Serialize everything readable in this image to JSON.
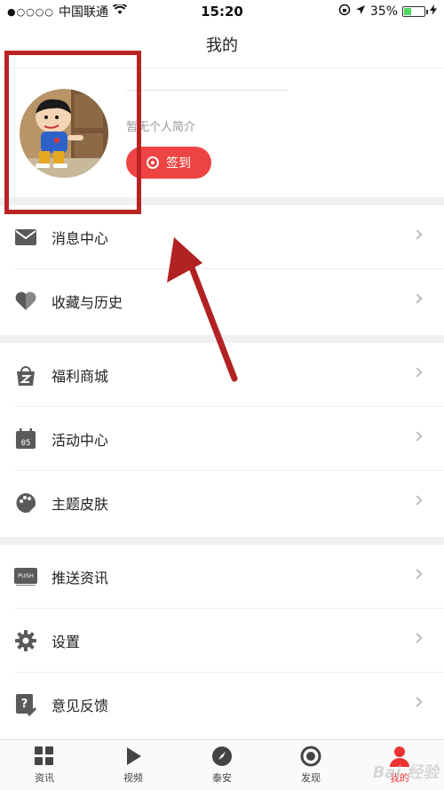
{
  "status_bar": {
    "carrier": "中国联通",
    "time": "15:20",
    "battery": "35%",
    "battery_level": 0.35
  },
  "nav": {
    "title": "我的"
  },
  "profile": {
    "bio": "暂无个人简介",
    "checkin_label": "签到"
  },
  "menu": {
    "group1": [
      {
        "label": "消息中心",
        "icon": "mail-icon"
      },
      {
        "label": "收藏与历史",
        "icon": "heart-icon"
      }
    ],
    "group2": [
      {
        "label": "福利商城",
        "icon": "shopping-bag-icon"
      },
      {
        "label": "活动中心",
        "icon": "calendar-icon",
        "icon_text": "05"
      },
      {
        "label": "主题皮肤",
        "icon": "palette-icon"
      }
    ],
    "group3": [
      {
        "label": "推送资讯",
        "icon": "push-icon",
        "icon_text": "PUSH"
      },
      {
        "label": "设置",
        "icon": "gear-icon"
      },
      {
        "label": "意见反馈",
        "icon": "feedback-icon"
      }
    ]
  },
  "tabs": [
    {
      "label": "资讯",
      "icon": "grid-icon"
    },
    {
      "label": "视频",
      "icon": "play-icon"
    },
    {
      "label": "泰安",
      "icon": "compass-icon"
    },
    {
      "label": "发现",
      "icon": "discover-icon"
    },
    {
      "label": "我的",
      "icon": "person-icon",
      "active": true
    }
  ],
  "colors": {
    "accent": "#ee4444",
    "annotation": "#b22222",
    "icon_gray": "#5a5a5a"
  },
  "watermark": "Bai 经验"
}
